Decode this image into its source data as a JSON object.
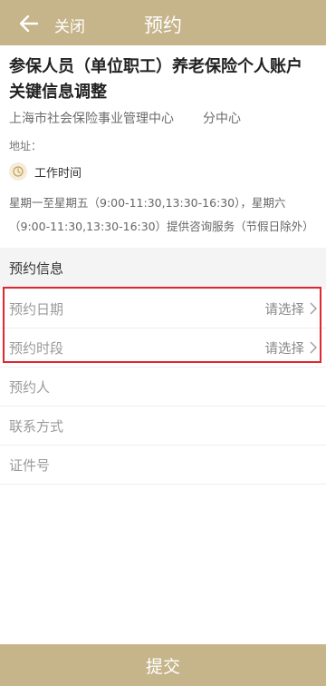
{
  "header": {
    "close_label": "关闭",
    "title": "预约",
    "back_icon": "arrow-left-icon",
    "bg_color": "#c6b48a"
  },
  "service": {
    "title": "参保人员（单位职工）养老保险个人账户关键信息调整",
    "department": "上海市社会保险事业管理中心",
    "branch": "分中心",
    "address_label": "地址：",
    "worktime_label": "工作时间",
    "worktime_detail": "星期一至星期五（9:00-11:30,13:30-16:30），星期六（9:00-11:30,13:30-16:30）提供咨询服务（节假日除外）",
    "clock_icon": "clock-icon"
  },
  "form": {
    "section_title": "预约信息",
    "date_label": "预约日期",
    "date_value": "请选择",
    "period_label": "预约时段",
    "period_value": "请选择",
    "person_label": "预约人",
    "contact_label": "联系方式",
    "id_label": "证件号",
    "highlight_color": "#e0262e"
  },
  "footer": {
    "submit_label": "提交"
  }
}
